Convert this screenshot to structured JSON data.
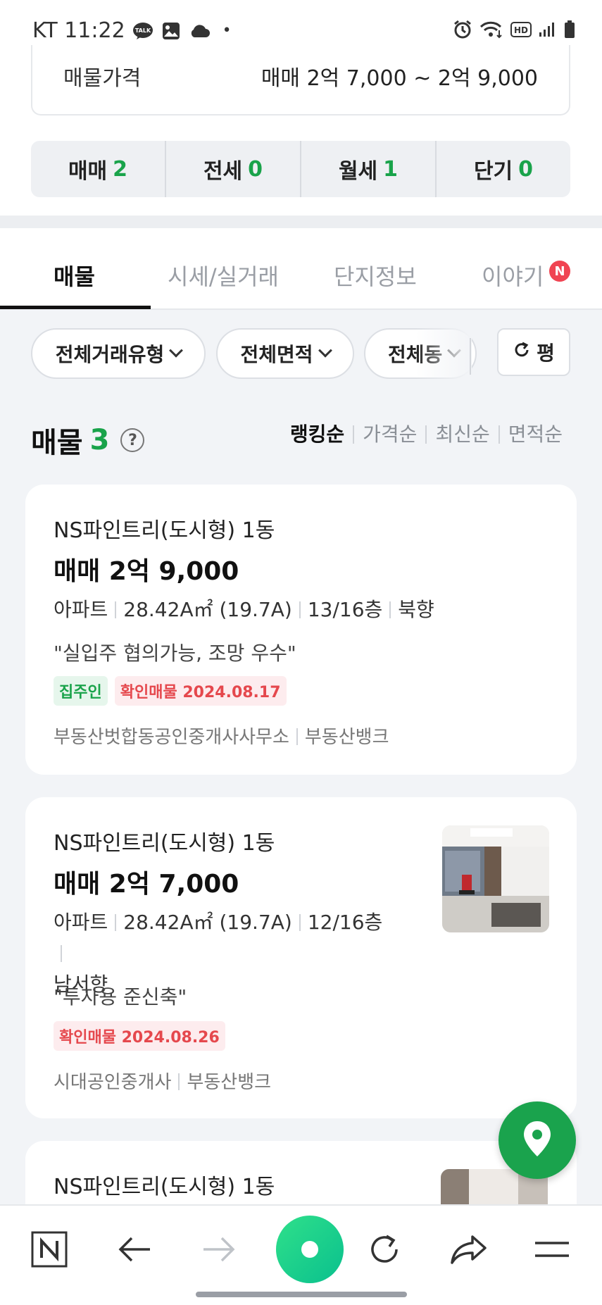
{
  "status": {
    "carrier_time": "KT 11:22",
    "talk_label": "TALK",
    "dot": "•",
    "hd_label": "HD"
  },
  "price_card": {
    "label": "매물가격",
    "value": "매매 2억 7,000 ~ 2억 9,000"
  },
  "deal_types": [
    {
      "label": "매매",
      "count": "2"
    },
    {
      "label": "전세",
      "count": "0"
    },
    {
      "label": "월세",
      "count": "1"
    },
    {
      "label": "단기",
      "count": "0"
    }
  ],
  "tabs": [
    {
      "label": "매물",
      "active": true
    },
    {
      "label": "시세/실거래"
    },
    {
      "label": "단지정보"
    },
    {
      "label": "이야기",
      "badge": "N"
    }
  ],
  "filters": {
    "deal": "전체거래유형",
    "area": "전체면적",
    "dong": "전체동",
    "unit": "평"
  },
  "list": {
    "title": "매물",
    "count": "3",
    "help": "?",
    "sorts": [
      "랭킹순",
      "가격순",
      "최신순",
      "면적순"
    ]
  },
  "listings": [
    {
      "name": "NS파인트리(도시형) 1동",
      "price": "매매 2억 9,000",
      "info": [
        "아파트",
        "28.42A㎡ (19.7A)",
        "13/16층",
        "북향"
      ],
      "desc": "\"실입주 협의가능, 조망 우수\"",
      "tag_owner": "집주인",
      "tag_confirm": "확인매물 2024.08.17",
      "agents": [
        "부동산벗합동공인중개사사무소",
        "부동산뱅크"
      ]
    },
    {
      "name": "NS파인트리(도시형) 1동",
      "price": "매매 2억 7,000",
      "info_line1": [
        "아파트",
        "28.42A㎡ (19.7A)",
        "12/16층"
      ],
      "info_line2": "남서향",
      "desc": "\"투자용 준신축\"",
      "tag_confirm": "확인매물 2024.08.26",
      "agents": [
        "시대공인중개사",
        "부동산뱅크"
      ]
    },
    {
      "name": "NS파인트리(도시형) 1동"
    }
  ],
  "colors": {
    "accent_green": "#19a34a",
    "badge_red": "#f04452",
    "confirm_red": "#e5484d",
    "fab_green": "#1aa34d"
  }
}
